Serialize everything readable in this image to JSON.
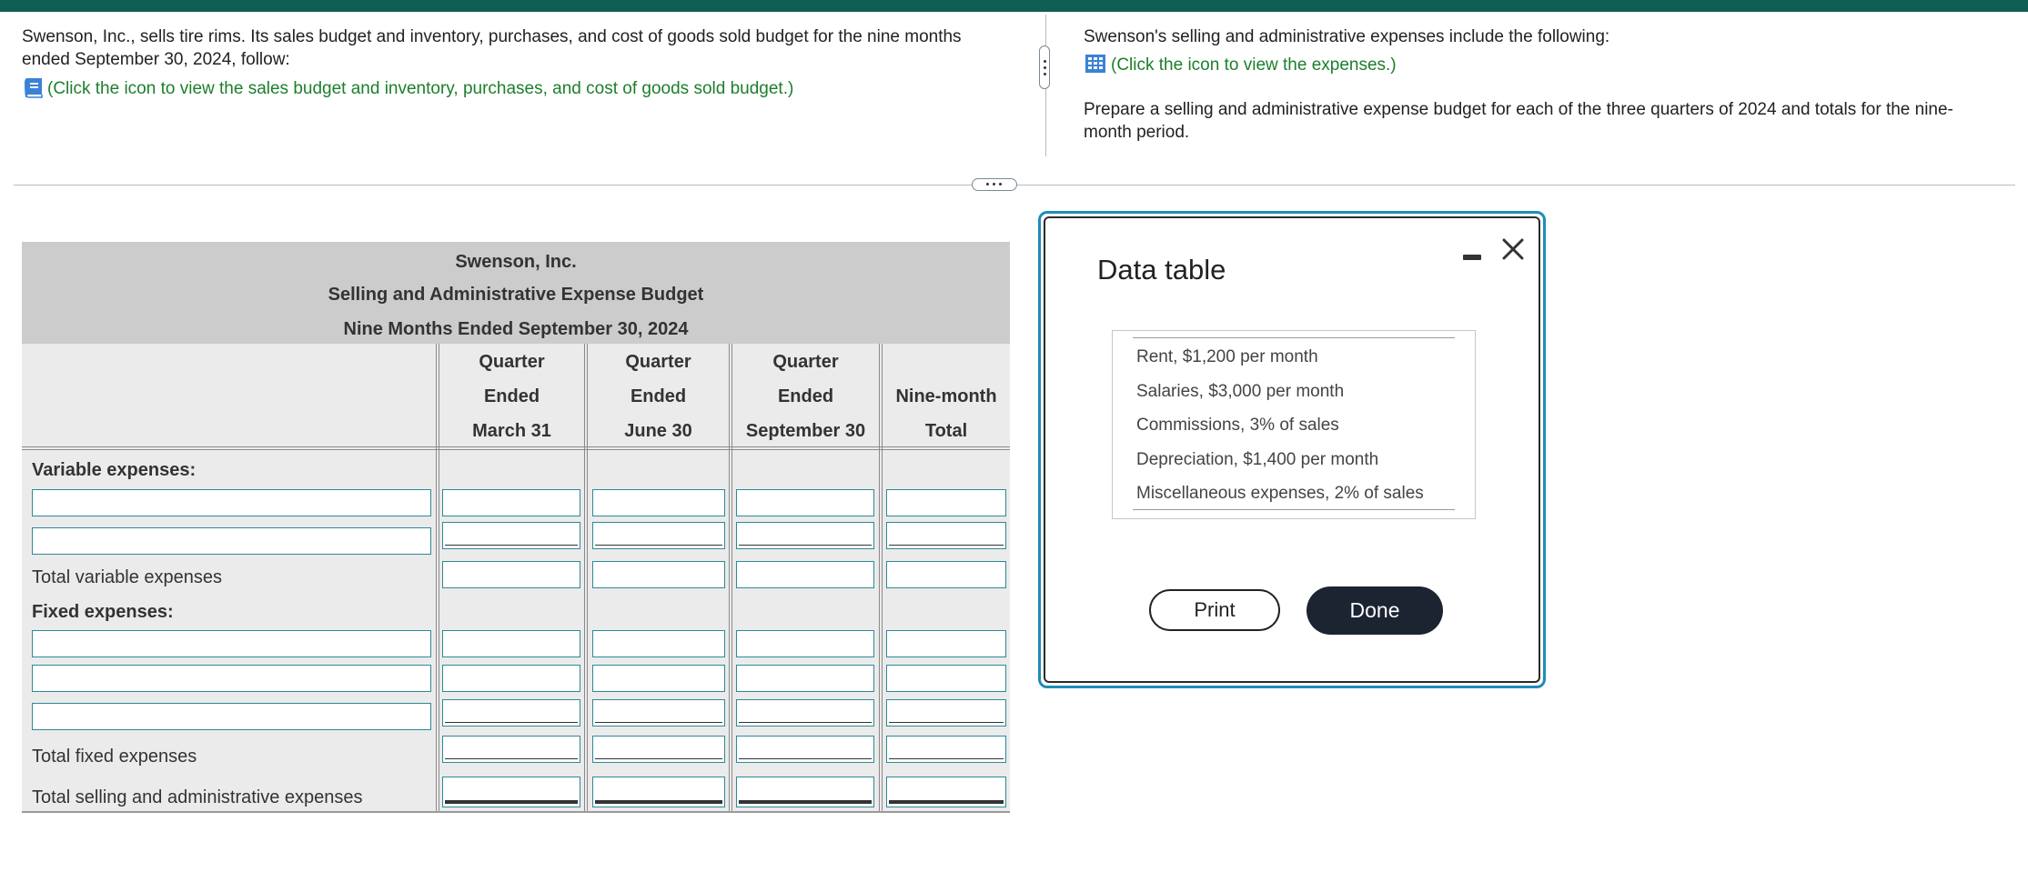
{
  "prompt": {
    "intro": "Swenson, Inc., sells tire rims. Its sales budget and inventory, purchases, and cost of goods sold budget for the nine months ended September 30, 2024, follow:",
    "sales_link": "(Click the icon to view the sales budget and inventory, purchases, and cost of goods sold budget.)",
    "expenses_intro": "Swenson's selling and administrative expenses include the following:",
    "expenses_link": "(Click the icon to view the expenses.)",
    "instruction": "Prepare a selling and administrative expense budget for each of the three quarters of 2024 and totals for the nine-month period."
  },
  "budget": {
    "company": "Swenson, Inc.",
    "title": "Selling and Administrative Expense Budget",
    "period": "Nine Months Ended September 30, 2024",
    "columns": [
      {
        "line1": "Quarter",
        "line2": "Ended",
        "line3": "March 31"
      },
      {
        "line1": "Quarter",
        "line2": "Ended",
        "line3": "June 30"
      },
      {
        "line1": "Quarter",
        "line2": "Ended",
        "line3": "September 30"
      },
      {
        "line1": "",
        "line2": "Nine-month",
        "line3": "Total"
      }
    ],
    "labels": {
      "variable": "Variable expenses:",
      "total_variable": "Total variable expenses",
      "fixed": "Fixed expenses:",
      "total_fixed": "Total fixed expenses",
      "total_sa": "Total selling and administrative expenses"
    }
  },
  "modal": {
    "title": "Data table",
    "rows": [
      "Rent, $1,200 per month",
      "Salaries, $3,000 per month",
      "Commissions, 3% of sales",
      "Depreciation, $1,400 per month",
      "Miscellaneous expenses, 2% of sales"
    ],
    "print_label": "Print",
    "done_label": "Done"
  },
  "colors": {
    "top_bar": "#0f5e56",
    "link": "#1c7f2b",
    "input_border": "#2c8a96",
    "modal_border": "#1e8db7",
    "done_button": "#1c2331"
  },
  "icons": [
    "book-icon",
    "table-icon",
    "minimize-icon",
    "close-icon"
  ]
}
